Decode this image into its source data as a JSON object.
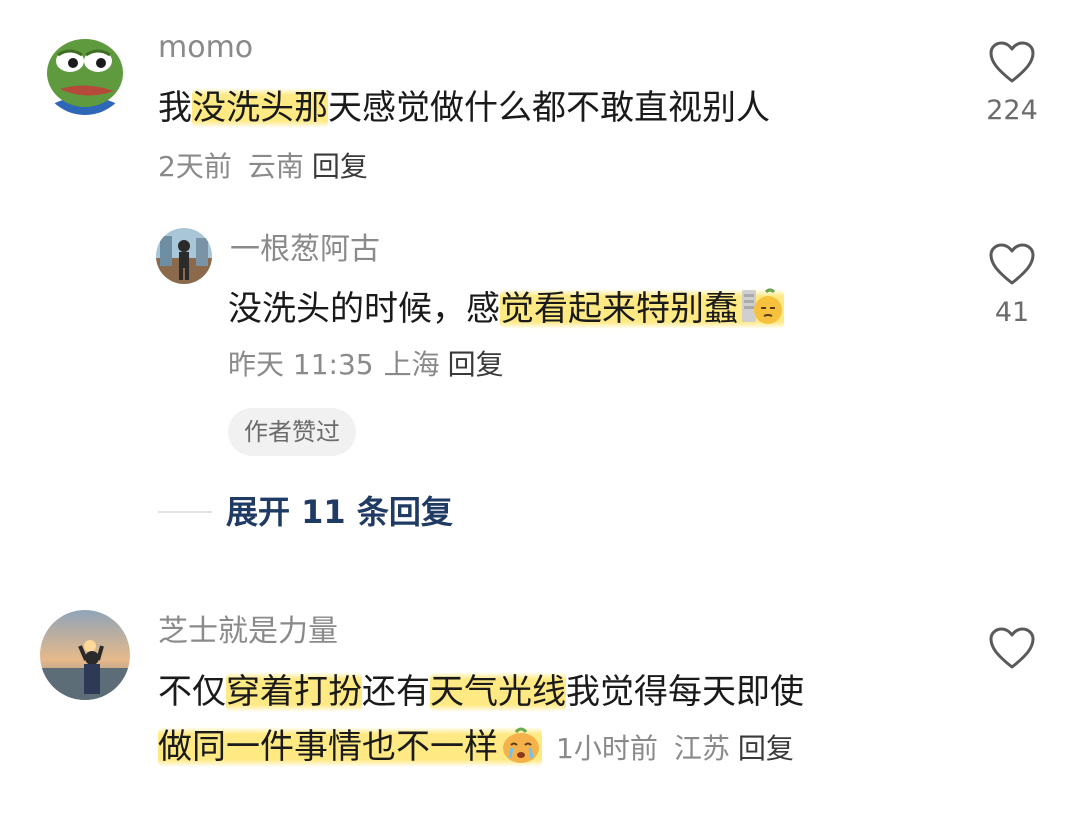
{
  "comments": [
    {
      "username": "momo",
      "text_parts": [
        "我",
        "没洗头那",
        "天感觉做什么都不敢直视别人"
      ],
      "time": "2天前",
      "location": "云南",
      "reply_label": "回复",
      "likes": "224",
      "avatar_icon": "frog-avatar",
      "reply": {
        "username": "一根葱阿古",
        "text_parts": [
          "没洗头的时候，感",
          "觉看起来特别蠢"
        ],
        "emoji_icon": "embarrassed-emoji",
        "time": "昨天 11:35",
        "location": "上海",
        "reply_label": "回复",
        "likes": "41",
        "author_liked": "作者赞过",
        "avatar_icon": "person-photo-avatar"
      },
      "expand_label": "展开 11 条回复"
    },
    {
      "username": "芝士就是力量",
      "line1_parts": [
        "不仅",
        "穿着打扮",
        "还有",
        "天气光线",
        "我觉得每天即使"
      ],
      "line2_parts": [
        "做同一件事情也不一样"
      ],
      "emoji_icon": "crying-emoji",
      "time": "1小时前",
      "location": "江苏",
      "reply_label": "回复",
      "likes": "",
      "avatar_icon": "sunset-photo-avatar"
    }
  ],
  "colors": {
    "highlight": "#ffe25a",
    "username": "#8a8a8a",
    "expand": "#1f3a63"
  }
}
